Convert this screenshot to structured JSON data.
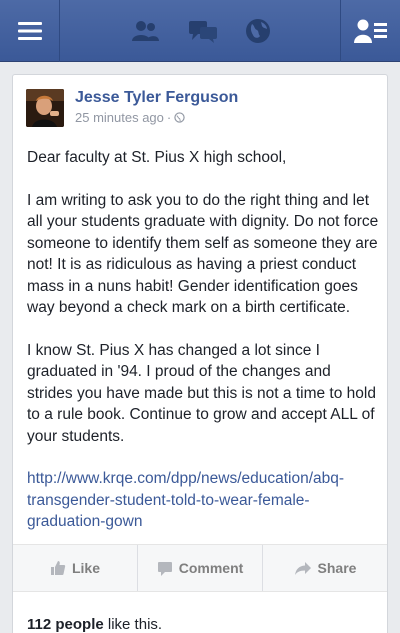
{
  "topbar": {
    "icons": [
      "menu-icon",
      "friends-icon",
      "messages-icon",
      "globe-icon",
      "friend-requests-icon"
    ],
    "bg_color": "#3b5998"
  },
  "post": {
    "author": "Jesse Tyler Ferguson",
    "time": "25 minutes ago",
    "privacy_icon": "globe-icon",
    "paragraphs": [
      "Dear faculty at St. Pius X high school,",
      "I am writing to ask you to do the right thing and let all your students graduate with dignity. Do not force someone to identify them self as someone they are not! It is as ridiculous  as having a priest conduct mass in a nuns habit! Gender identification goes way beyond a check mark on a birth certificate.",
      "I know St. Pius X has changed a lot since I graduated in '94. I proud of the changes and strides you have made but this is not a time to hold to a rule book. Continue to grow and accept ALL of your students."
    ],
    "link": "http://www.krqe.com/dpp/news/education/abq-transgender-student-told-to-wear-female-graduation-gown"
  },
  "actions": {
    "like": "Like",
    "comment": "Comment",
    "share": "Share"
  },
  "likes": {
    "count_text": "112 people",
    "suffix": " like this."
  }
}
